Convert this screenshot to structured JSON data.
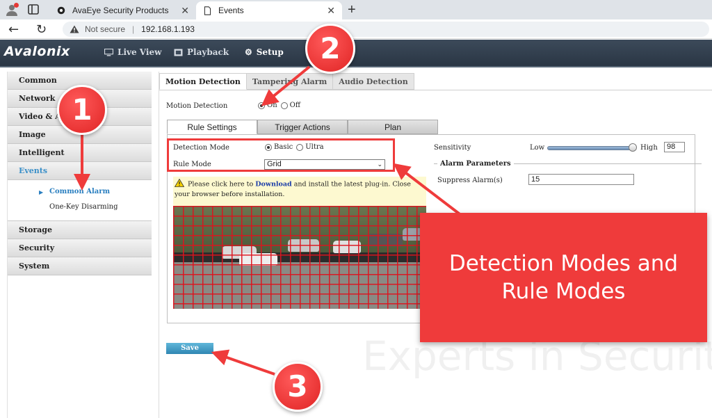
{
  "browser": {
    "tabs": [
      {
        "label": "AvaEye Security Products"
      },
      {
        "label": "Events"
      }
    ],
    "address": {
      "security": "Not secure",
      "url": "192.168.1.193"
    }
  },
  "app": {
    "logo": "Avalonix",
    "nav": [
      {
        "label": "Live View"
      },
      {
        "label": "Playback"
      },
      {
        "label": "Setup"
      }
    ]
  },
  "menu": {
    "items": [
      {
        "label": "Common"
      },
      {
        "label": "Network"
      },
      {
        "label": "Video & A"
      },
      {
        "label": "Image"
      },
      {
        "label": "Intelligent"
      },
      {
        "label": "Events"
      },
      {
        "label": "Storage"
      },
      {
        "label": "Security"
      },
      {
        "label": "System"
      }
    ],
    "submenu": [
      {
        "label": "Common Alarm"
      },
      {
        "label": "One-Key Disarming"
      }
    ]
  },
  "content": {
    "tabs": [
      {
        "label": "Motion Detection"
      },
      {
        "label": "Tampering Alarm"
      },
      {
        "label": "Audio Detection"
      }
    ],
    "motion_detection": {
      "label": "Motion Detection",
      "on": "On",
      "off": "Off",
      "selected": "On"
    },
    "subtabs": [
      {
        "label": "Rule Settings"
      },
      {
        "label": "Trigger Actions"
      },
      {
        "label": "Plan"
      }
    ],
    "detection_mode": {
      "label": "Detection Mode",
      "options": [
        "Basic",
        "Ultra"
      ],
      "selected": "Basic"
    },
    "rule_mode": {
      "label": "Rule Mode",
      "value": "Grid"
    },
    "plugin_notice": {
      "before": "Please click here to",
      "link": "Download",
      "after": "and install the latest plug-in. Close your browser before installation."
    },
    "sensitivity": {
      "label": "Sensitivity",
      "low": "Low",
      "high": "High",
      "value": "98"
    },
    "alarm_parameters": {
      "legend": "Alarm Parameters",
      "suppress_label": "Suppress Alarm(s)",
      "suppress_value": "15"
    },
    "save_label": "Save",
    "watermark": "Experts in Security & S"
  },
  "annotations": {
    "badges": [
      "1",
      "2",
      "3"
    ],
    "callout": "Detection Modes and Rule Modes",
    "color": "#ef3b3b"
  }
}
